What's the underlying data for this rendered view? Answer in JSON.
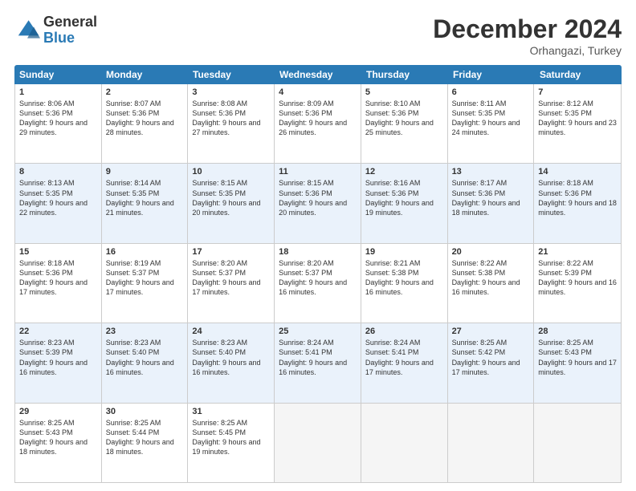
{
  "logo": {
    "general": "General",
    "blue": "Blue"
  },
  "title": "December 2024",
  "subtitle": "Orhangazi, Turkey",
  "headers": [
    "Sunday",
    "Monday",
    "Tuesday",
    "Wednesday",
    "Thursday",
    "Friday",
    "Saturday"
  ],
  "weeks": [
    [
      {
        "day": "1",
        "sunrise": "Sunrise: 8:06 AM",
        "sunset": "Sunset: 5:36 PM",
        "daylight": "Daylight: 9 hours and 29 minutes."
      },
      {
        "day": "2",
        "sunrise": "Sunrise: 8:07 AM",
        "sunset": "Sunset: 5:36 PM",
        "daylight": "Daylight: 9 hours and 28 minutes."
      },
      {
        "day": "3",
        "sunrise": "Sunrise: 8:08 AM",
        "sunset": "Sunset: 5:36 PM",
        "daylight": "Daylight: 9 hours and 27 minutes."
      },
      {
        "day": "4",
        "sunrise": "Sunrise: 8:09 AM",
        "sunset": "Sunset: 5:36 PM",
        "daylight": "Daylight: 9 hours and 26 minutes."
      },
      {
        "day": "5",
        "sunrise": "Sunrise: 8:10 AM",
        "sunset": "Sunset: 5:36 PM",
        "daylight": "Daylight: 9 hours and 25 minutes."
      },
      {
        "day": "6",
        "sunrise": "Sunrise: 8:11 AM",
        "sunset": "Sunset: 5:35 PM",
        "daylight": "Daylight: 9 hours and 24 minutes."
      },
      {
        "day": "7",
        "sunrise": "Sunrise: 8:12 AM",
        "sunset": "Sunset: 5:35 PM",
        "daylight": "Daylight: 9 hours and 23 minutes."
      }
    ],
    [
      {
        "day": "8",
        "sunrise": "Sunrise: 8:13 AM",
        "sunset": "Sunset: 5:35 PM",
        "daylight": "Daylight: 9 hours and 22 minutes."
      },
      {
        "day": "9",
        "sunrise": "Sunrise: 8:14 AM",
        "sunset": "Sunset: 5:35 PM",
        "daylight": "Daylight: 9 hours and 21 minutes."
      },
      {
        "day": "10",
        "sunrise": "Sunrise: 8:15 AM",
        "sunset": "Sunset: 5:35 PM",
        "daylight": "Daylight: 9 hours and 20 minutes."
      },
      {
        "day": "11",
        "sunrise": "Sunrise: 8:15 AM",
        "sunset": "Sunset: 5:36 PM",
        "daylight": "Daylight: 9 hours and 20 minutes."
      },
      {
        "day": "12",
        "sunrise": "Sunrise: 8:16 AM",
        "sunset": "Sunset: 5:36 PM",
        "daylight": "Daylight: 9 hours and 19 minutes."
      },
      {
        "day": "13",
        "sunrise": "Sunrise: 8:17 AM",
        "sunset": "Sunset: 5:36 PM",
        "daylight": "Daylight: 9 hours and 18 minutes."
      },
      {
        "day": "14",
        "sunrise": "Sunrise: 8:18 AM",
        "sunset": "Sunset: 5:36 PM",
        "daylight": "Daylight: 9 hours and 18 minutes."
      }
    ],
    [
      {
        "day": "15",
        "sunrise": "Sunrise: 8:18 AM",
        "sunset": "Sunset: 5:36 PM",
        "daylight": "Daylight: 9 hours and 17 minutes."
      },
      {
        "day": "16",
        "sunrise": "Sunrise: 8:19 AM",
        "sunset": "Sunset: 5:37 PM",
        "daylight": "Daylight: 9 hours and 17 minutes."
      },
      {
        "day": "17",
        "sunrise": "Sunrise: 8:20 AM",
        "sunset": "Sunset: 5:37 PM",
        "daylight": "Daylight: 9 hours and 17 minutes."
      },
      {
        "day": "18",
        "sunrise": "Sunrise: 8:20 AM",
        "sunset": "Sunset: 5:37 PM",
        "daylight": "Daylight: 9 hours and 16 minutes."
      },
      {
        "day": "19",
        "sunrise": "Sunrise: 8:21 AM",
        "sunset": "Sunset: 5:38 PM",
        "daylight": "Daylight: 9 hours and 16 minutes."
      },
      {
        "day": "20",
        "sunrise": "Sunrise: 8:22 AM",
        "sunset": "Sunset: 5:38 PM",
        "daylight": "Daylight: 9 hours and 16 minutes."
      },
      {
        "day": "21",
        "sunrise": "Sunrise: 8:22 AM",
        "sunset": "Sunset: 5:39 PM",
        "daylight": "Daylight: 9 hours and 16 minutes."
      }
    ],
    [
      {
        "day": "22",
        "sunrise": "Sunrise: 8:23 AM",
        "sunset": "Sunset: 5:39 PM",
        "daylight": "Daylight: 9 hours and 16 minutes."
      },
      {
        "day": "23",
        "sunrise": "Sunrise: 8:23 AM",
        "sunset": "Sunset: 5:40 PM",
        "daylight": "Daylight: 9 hours and 16 minutes."
      },
      {
        "day": "24",
        "sunrise": "Sunrise: 8:23 AM",
        "sunset": "Sunset: 5:40 PM",
        "daylight": "Daylight: 9 hours and 16 minutes."
      },
      {
        "day": "25",
        "sunrise": "Sunrise: 8:24 AM",
        "sunset": "Sunset: 5:41 PM",
        "daylight": "Daylight: 9 hours and 16 minutes."
      },
      {
        "day": "26",
        "sunrise": "Sunrise: 8:24 AM",
        "sunset": "Sunset: 5:41 PM",
        "daylight": "Daylight: 9 hours and 17 minutes."
      },
      {
        "day": "27",
        "sunrise": "Sunrise: 8:25 AM",
        "sunset": "Sunset: 5:42 PM",
        "daylight": "Daylight: 9 hours and 17 minutes."
      },
      {
        "day": "28",
        "sunrise": "Sunrise: 8:25 AM",
        "sunset": "Sunset: 5:43 PM",
        "daylight": "Daylight: 9 hours and 17 minutes."
      }
    ],
    [
      {
        "day": "29",
        "sunrise": "Sunrise: 8:25 AM",
        "sunset": "Sunset: 5:43 PM",
        "daylight": "Daylight: 9 hours and 18 minutes."
      },
      {
        "day": "30",
        "sunrise": "Sunrise: 8:25 AM",
        "sunset": "Sunset: 5:44 PM",
        "daylight": "Daylight: 9 hours and 18 minutes."
      },
      {
        "day": "31",
        "sunrise": "Sunrise: 8:25 AM",
        "sunset": "Sunset: 5:45 PM",
        "daylight": "Daylight: 9 hours and 19 minutes."
      },
      null,
      null,
      null,
      null
    ]
  ]
}
